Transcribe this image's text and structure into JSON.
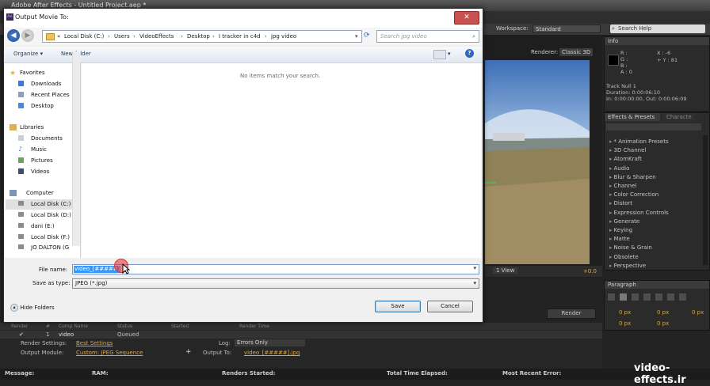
{
  "app": {
    "title": "Adobe After Effects - Untitled Project.aep *",
    "workspace_label": "Workspace:",
    "workspace_value": "Standard",
    "search_help": "Search Help",
    "renderer_label": "Renderer:",
    "renderer_value": "Classic 3D",
    "info_tab": "Info",
    "info_lines": [
      "R :",
      "G :",
      "B :",
      "A : 0"
    ],
    "info_coords": [
      "X : -6",
      "+ Y : 81"
    ],
    "track_lines": [
      "Track Null 1",
      "Duration: 0:00:06:10",
      "In: 0:00:00:00, Out: 0:00:06:09"
    ],
    "effects_tab": "Effects & Presets",
    "character_tab": "Characte",
    "effects_items": [
      "* Animation Presets",
      "3D Channel",
      "AtomKraft",
      "Audio",
      "Blur & Sharpen",
      "Channel",
      "Color Correction",
      "Distort",
      "Expression Controls",
      "Generate",
      "Keying",
      "Matte",
      "Noise & Grain",
      "Obsolete",
      "Perspective"
    ],
    "paragraph_tab": "Paragraph",
    "paragraph_values": [
      "0 px",
      "0 px",
      "0 px",
      "0 px",
      "0 px"
    ],
    "viewer_view": "1 View",
    "viewer_offset": "+0.0",
    "render_button": "Render",
    "rq_headers": [
      "Render",
      "#",
      "Comp Name",
      "Status",
      "Started",
      "Render Time"
    ],
    "rq_row": {
      "num": "1",
      "comp": "video",
      "status": "Queued"
    },
    "render_settings_label": "Render Settings:",
    "render_settings_value": "Best Settings",
    "output_module_label": "Output Module:",
    "output_module_value": "Custom: JPEG Sequence",
    "log_label": "Log:",
    "log_value": "Errors Only",
    "output_to_label": "Output To:",
    "output_to_value": "video_[#####].jpg",
    "status_bar": [
      "Message:",
      "RAM:",
      "Renders Started:",
      "Total Time Elapsed:",
      "Most Recent Error:"
    ],
    "watermark": "video-effects.ir"
  },
  "dialog": {
    "title": "Output Movie To:",
    "close": "✕",
    "back": "◀",
    "forward": "▶",
    "breadcrumb": [
      "«",
      "Local Disk (C:)",
      "Users",
      "VideoEffects",
      "Desktop",
      "I tracker in c4d",
      "jpg video"
    ],
    "search_placeholder": "Search jpg video",
    "organize": "Organize ▾",
    "new_folder": "New folder",
    "help": "?",
    "favorites": "Favorites",
    "favorite_items": [
      "Downloads",
      "Recent Places",
      "Desktop"
    ],
    "libraries": "Libraries",
    "library_items": [
      "Documents",
      "Music",
      "Pictures",
      "Videos"
    ],
    "computer": "Computer",
    "computer_items": [
      "Local Disk (C:)",
      "Local Disk (D:)",
      "dani (E:)",
      "Local Disk (F:)",
      "JO DALTON (G"
    ],
    "empty_message": "No items match your search.",
    "file_name_label": "File name:",
    "file_name_value": "video_[#####]",
    "save_as_label": "Save as type:",
    "save_as_value": "JPEG (*.jpg)",
    "hide_folders": "Hide Folders",
    "save": "Save",
    "cancel": "Cancel"
  }
}
